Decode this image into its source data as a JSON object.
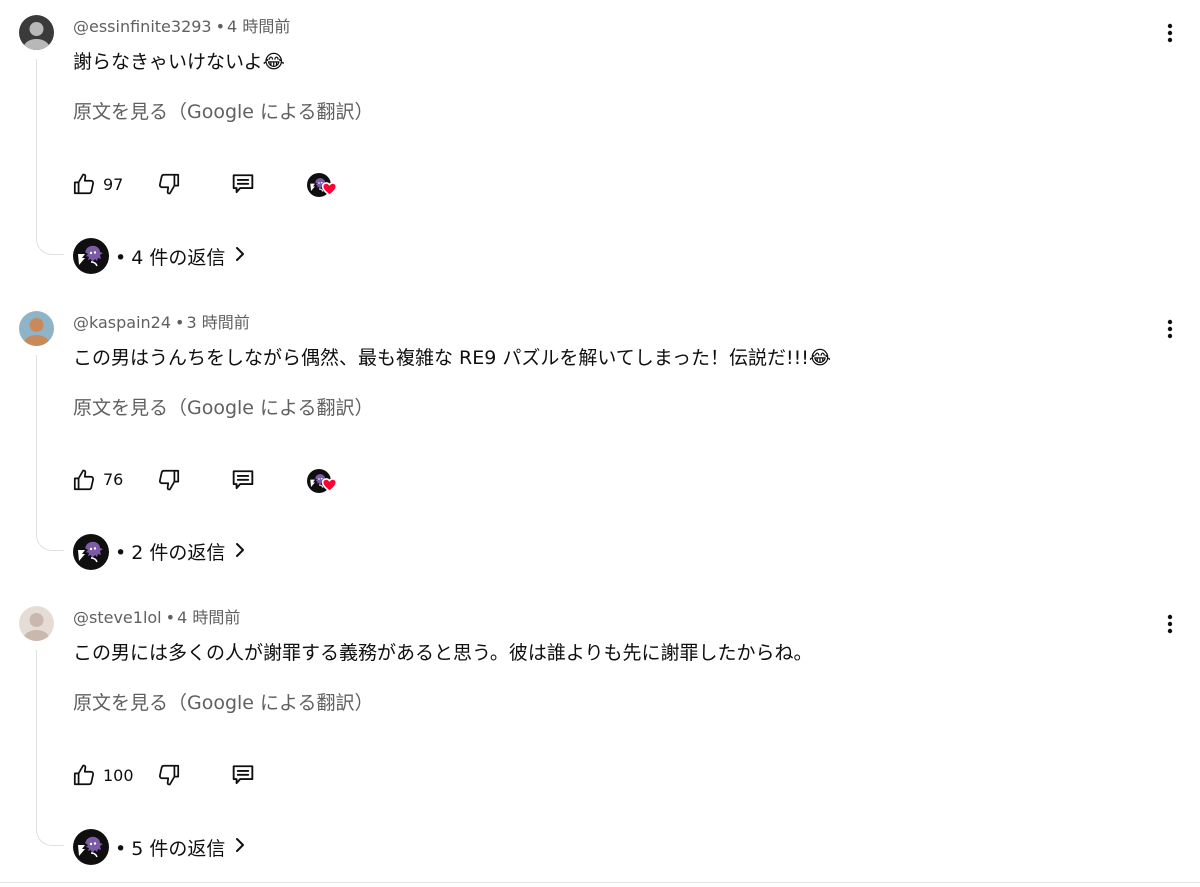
{
  "comments": [
    {
      "handle": "@essinfinite3293",
      "time": "4 時間前",
      "text": "謝らなきゃいけないよ😂",
      "translate_label": "原文を見る（Google による翻訳）",
      "likes": "97",
      "creator_heart": true,
      "reply_count_text": "4 件の返信",
      "avatar_icon": "user-avatar-icon",
      "colors": {
        "avatar_bg": "#3a3a3a",
        "avatar_fg": "#b8b8b8"
      }
    },
    {
      "handle": "@kaspain24",
      "time": "3 時間前",
      "text": "この男はうんちをしながら偶然、最も複雑な RE9 パズルを解いてしまった！伝説だ!!!😂",
      "translate_label": "原文を見る（Google による翻訳）",
      "likes": "76",
      "creator_heart": true,
      "reply_count_text": "2 件の返信",
      "avatar_icon": "user-avatar-icon",
      "colors": {
        "avatar_bg": "#8fb4c8",
        "avatar_fg": "#c88a5a"
      }
    },
    {
      "handle": "@steve1lol",
      "time": "4 時間前",
      "text": "この男には多くの人が謝罪する義務があると思う。彼は誰よりも先に謝罪したからね。",
      "translate_label": "原文を見る（Google による翻訳）",
      "likes": "100",
      "creator_heart": false,
      "reply_count_text": "5 件の返信",
      "avatar_icon": "user-avatar-icon",
      "colors": {
        "avatar_bg": "#e6dcd6",
        "avatar_fg": "#c9b8ae"
      }
    }
  ],
  "separator": "•",
  "icons": {
    "like": "thumb-up-icon",
    "dislike": "thumb-down-icon",
    "reply": "reply-icon",
    "creator": "creator-avatar-icon",
    "heart": "heart-icon",
    "menu": "more-vert-icon",
    "chevron": "chevron-right-icon"
  },
  "colors": {
    "text_primary": "#0f0f0f",
    "text_secondary": "#606060",
    "heart": "#ff0033",
    "creator_bg": "#0f0f0f",
    "creator_fg": "#7b5aa6"
  }
}
